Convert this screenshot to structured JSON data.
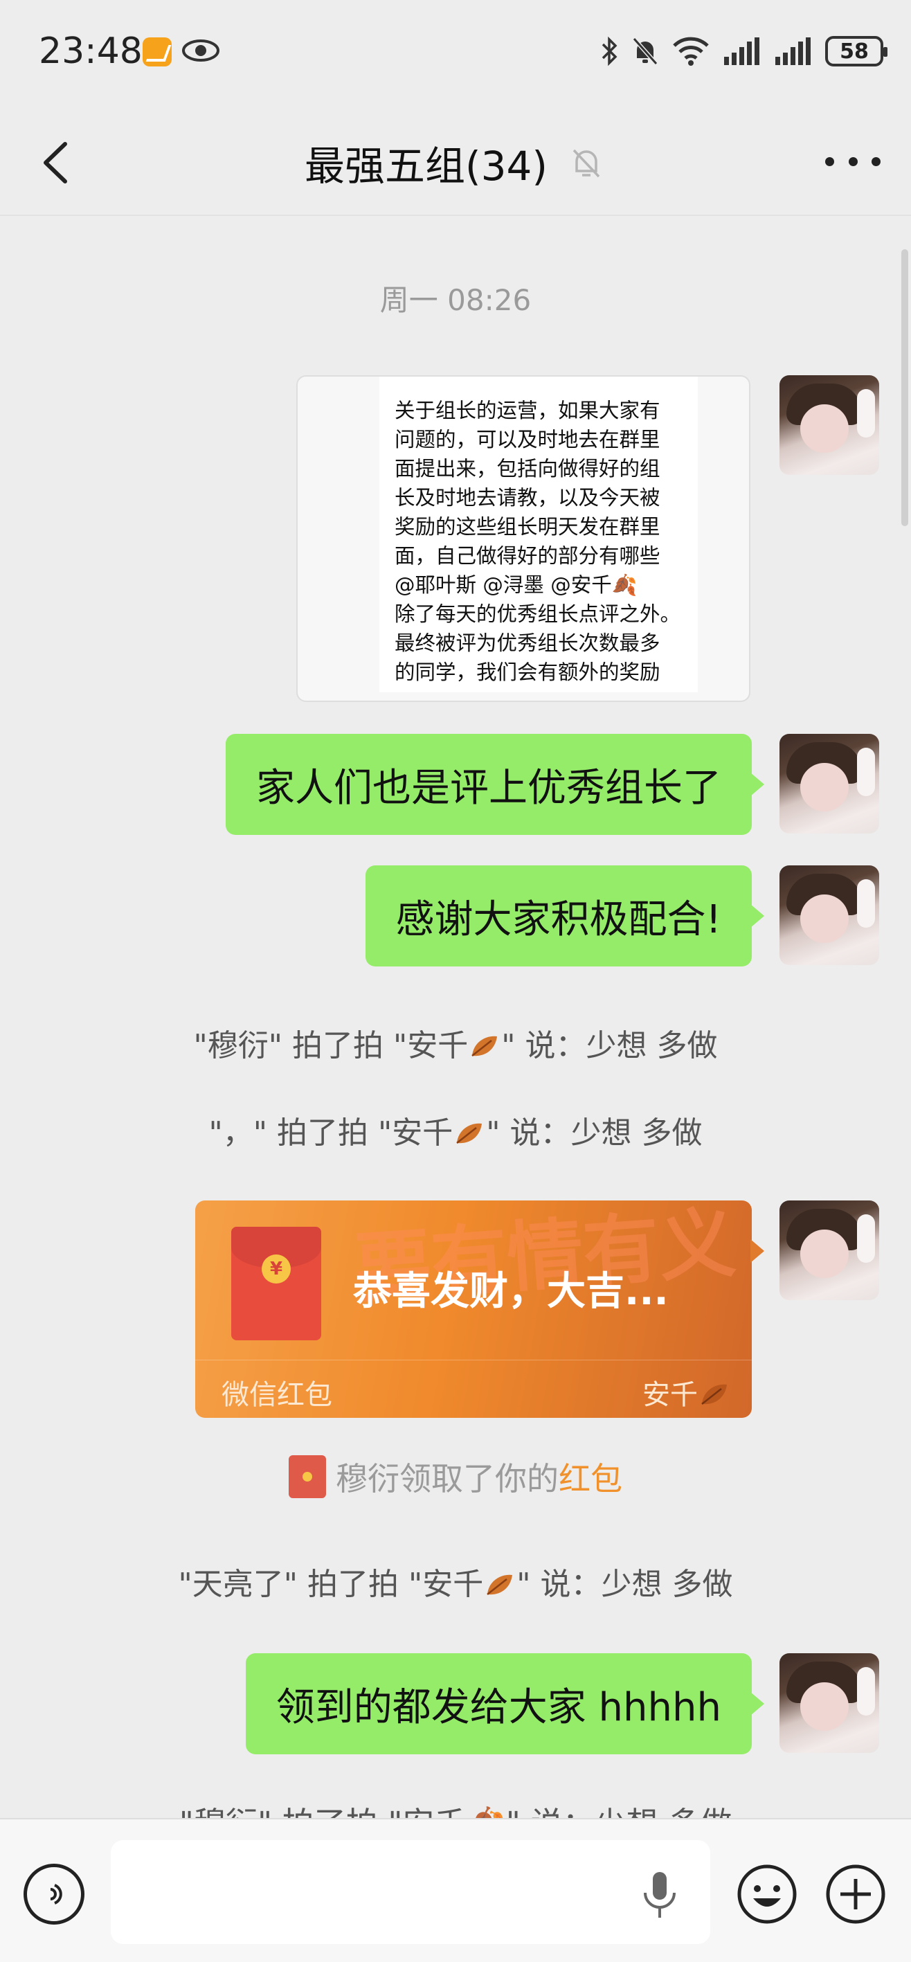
{
  "status_bar": {
    "time": "23:48",
    "battery": "58",
    "icons": [
      "app-badge-icon",
      "eye-icon",
      "bluetooth-icon",
      "mute-bell-icon",
      "wifi-icon",
      "signal-icon",
      "signal-icon",
      "battery-icon"
    ]
  },
  "header": {
    "title": "最强五组(34)",
    "back_icon": "chevron-left-icon",
    "mute_icon": "muted-bell-icon",
    "more_icon": "more-dots-icon"
  },
  "messages": {
    "timestamp": "周一 08:26",
    "image_text": [
      "关于组长的运营，如果大家有",
      "问题的，可以及时地去在群里",
      "面提出来，包括向做得好的组",
      "长及时地去请教，以及今天被",
      "奖励的这些组长明天发在群里",
      "面，自己做得好的部分有哪些",
      "@耶叶斯 @浔墨 @安千🍂",
      "除了每天的优秀组长点评之外。",
      "最终被评为优秀组长次数最多",
      "的同学，我们会有额外的奖励"
    ],
    "bubble1": "家人们也是评上优秀组长了",
    "bubble2": "感谢大家积极配合!",
    "pat1_prefix": "\"穆衍\" 拍了拍 \"安千",
    "pat1_suffix": "\" 说：少想 多做",
    "pat2_prefix": "\"，\" 拍了拍 \"安千",
    "pat2_suffix": "\" 说：少想 多做",
    "red_packet": {
      "title": "恭喜发财，大吉...",
      "label": "微信红包",
      "sender": "安千",
      "bg_text": "要有情有义",
      "coin": "¥"
    },
    "received_prefix": "穆衍领取了你的",
    "received_highlight": "红包",
    "pat3_prefix": "\"天亮了\" 拍了拍 \"安千",
    "pat3_suffix": "\" 说：少想 多做",
    "bubble3": "领到的都发给大家 hhhhh",
    "cut_text": "\"穆衍\" 拍了拍 \"安千🍂\" 说：少想 多做"
  },
  "input_bar": {
    "voice_icon": "voice-icon",
    "mic_icon": "microphone-icon",
    "emoji_icon": "emoji-icon",
    "plus_icon": "plus-icon"
  },
  "colors": {
    "bubble_green": "#95ec69",
    "background": "#ededed",
    "red_packet_orange": "#f08a2c",
    "highlight": "#f0912c"
  }
}
